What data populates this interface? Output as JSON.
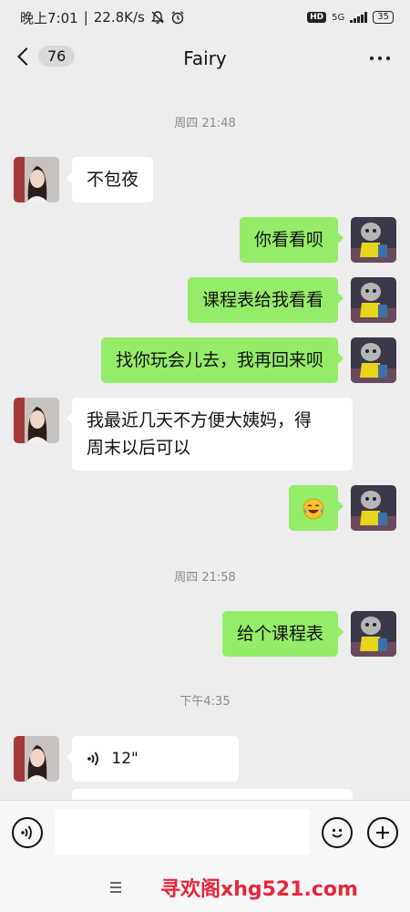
{
  "status_bar": {
    "time": "晚上7:01",
    "speed": "22.8K/s",
    "hd": "HD",
    "network": "5G",
    "battery": "35"
  },
  "nav": {
    "unread_count": "76",
    "title": "Fairy"
  },
  "messages": [
    {
      "type": "time",
      "text": "周四 21:48"
    },
    {
      "type": "text",
      "side": "left",
      "text": "不包夜"
    },
    {
      "type": "text",
      "side": "right",
      "text": "你看看呗"
    },
    {
      "type": "text",
      "side": "right",
      "text": "课程表给我看看"
    },
    {
      "type": "text",
      "side": "right",
      "text": "找你玩会儿去，我再回来呗"
    },
    {
      "type": "text",
      "side": "left",
      "line1": "我最近几天不方便大姨妈，得",
      "line2": "周末以后可以"
    },
    {
      "type": "emoji",
      "side": "right",
      "icon": "laughing-tears-emoji"
    },
    {
      "type": "time",
      "text": "周四 21:58"
    },
    {
      "type": "text",
      "side": "right",
      "text": "给个课程表"
    },
    {
      "type": "time",
      "text": "下午4:35"
    },
    {
      "type": "voice",
      "side": "left",
      "duration": "12\""
    }
  ],
  "watermark": "寻欢阁xhg521.com",
  "colors": {
    "background": "#ededed",
    "bubble_self": "#95ec69",
    "bubble_other": "#ffffff",
    "watermark": "#e8263a"
  }
}
